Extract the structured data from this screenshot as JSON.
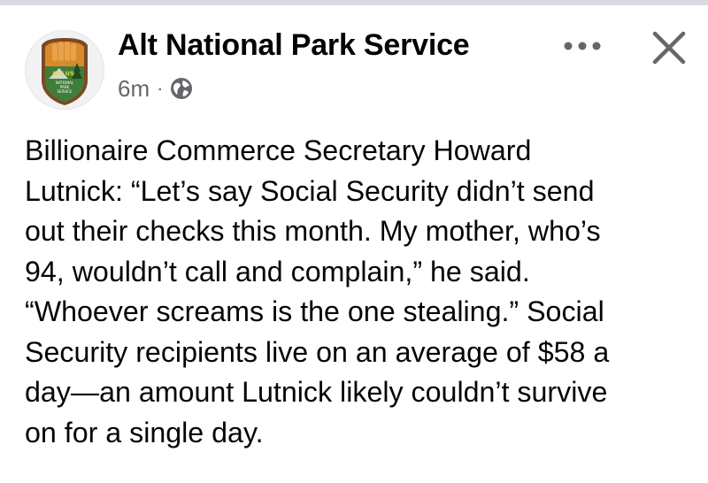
{
  "post": {
    "page_name": "Alt National Park Service",
    "timestamp": "6m",
    "separator": "·",
    "audience_icon": "globe-icon",
    "more_icon": "more-dots-icon",
    "close_icon": "close-icon",
    "avatar": {
      "icon": "alt-national-park-service-logo",
      "logo_text_top": "ALT US",
      "logo_text_lines": [
        "NATIONAL",
        "PARK",
        "SERVICE"
      ]
    },
    "text_lines": [
      "Billionaire Commerce Secretary Howard",
      "Lutnick: “Let’s say Social Security didn’t send",
      "out their checks this month. My mother, who’s",
      "94, wouldn’t call and complain,” he said.",
      "“Whoever screams is the one stealing.” Social",
      "Security recipients live on an average of $58 a",
      "day—an amount Lutnick likely couldn’t survive",
      "on for a single day."
    ]
  },
  "colors": {
    "text_primary": "#050505",
    "text_secondary": "#65676b",
    "top_strip": "#d8dadf",
    "logo_green": "#3f7d3a",
    "logo_brown": "#7a4a22",
    "logo_orange": "#d98a2b"
  }
}
